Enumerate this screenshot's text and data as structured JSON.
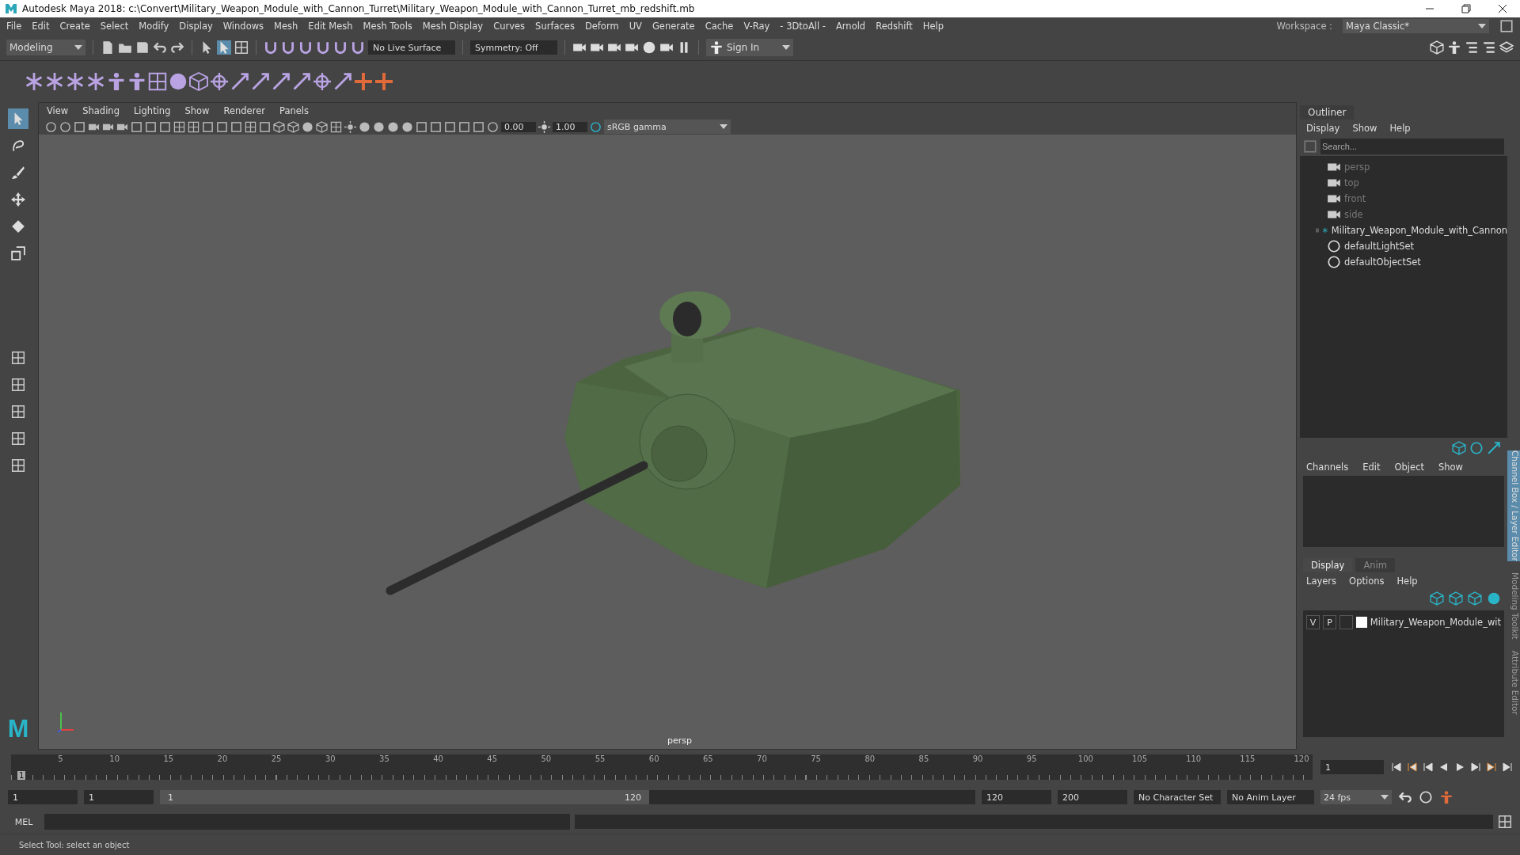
{
  "window": {
    "title": "Autodesk Maya 2018: c:\\Convert\\Military_Weapon_Module_with_Cannon_Turret\\Military_Weapon_Module_with_Cannon_Turret_mb_redshift.mb"
  },
  "menu_bar": [
    "File",
    "Edit",
    "Create",
    "Select",
    "Modify",
    "Display",
    "Windows",
    "Mesh",
    "Edit Mesh",
    "Mesh Tools",
    "Mesh Display",
    "Curves",
    "Surfaces",
    "Deform",
    "UV",
    "Generate",
    "Cache",
    "V-Ray",
    "- 3DtoAll -",
    "Arnold",
    "Redshift",
    "Help"
  ],
  "workspace": {
    "label": "Workspace :",
    "value": "Maya Classic*"
  },
  "status_line": {
    "mode": "Modeling",
    "live_surface": "No Live Surface",
    "symmetry": "Symmetry: Off",
    "sign_in": "Sign In"
  },
  "toolbox": {
    "logo": "M"
  },
  "viewport": {
    "menus": [
      "View",
      "Shading",
      "Lighting",
      "Show",
      "Renderer",
      "Panels"
    ],
    "exposure": "0.00",
    "gamma": "1.00",
    "color_space": "sRGB gamma",
    "camera_label": "persp"
  },
  "outliner": {
    "title": "Outliner",
    "menus": [
      "Display",
      "Show",
      "Help"
    ],
    "search": {
      "placeholder": "Search..."
    },
    "items": [
      {
        "label": "persp",
        "kind": "camera"
      },
      {
        "label": "top",
        "kind": "camera"
      },
      {
        "label": "front",
        "kind": "camera"
      },
      {
        "label": "side",
        "kind": "camera"
      },
      {
        "label": "Military_Weapon_Module_with_Cannon",
        "kind": "group"
      },
      {
        "label": "defaultLightSet",
        "kind": "set"
      },
      {
        "label": "defaultObjectSet",
        "kind": "set"
      }
    ]
  },
  "channel_box": {
    "menus": [
      "Channels",
      "Edit",
      "Object",
      "Show"
    ]
  },
  "layer_editor": {
    "tabs": [
      {
        "label": "Display",
        "selected": true
      },
      {
        "label": "Anim",
        "selected": false
      }
    ],
    "menus": [
      "Layers",
      "Options",
      "Help"
    ],
    "layers": [
      {
        "visible": "V",
        "playback": "P",
        "name": "Military_Weapon_Module_wit",
        "color": "#ffffff"
      }
    ]
  },
  "side_tabs": [
    {
      "label": "Channel Box / Layer Editor",
      "selected": true
    },
    {
      "label": "Modeling Toolkit",
      "selected": false
    },
    {
      "label": "Attribute Editor",
      "selected": false
    }
  ],
  "timeline": {
    "level": 0,
    "ticks": [
      "5",
      "10",
      "15",
      "20",
      "25",
      "30",
      "35",
      "40",
      "45",
      "50",
      "55",
      "60",
      "65",
      "70",
      "75",
      "80",
      "85",
      "90",
      "95",
      "100",
      "105",
      "110",
      "115",
      "120"
    ],
    "current_frame": "1",
    "frame_field": "1"
  },
  "range": {
    "level": 0.6,
    "start": "1",
    "playback_start": "1",
    "slider_start": "1",
    "slider_end": "120",
    "playback_end": "120",
    "end": "200",
    "character_set": "No Character Set",
    "anim_layer": "No Anim Layer",
    "fps": "24 fps"
  },
  "command_line": {
    "label": "MEL"
  },
  "help_line": "Select Tool: select an object"
}
